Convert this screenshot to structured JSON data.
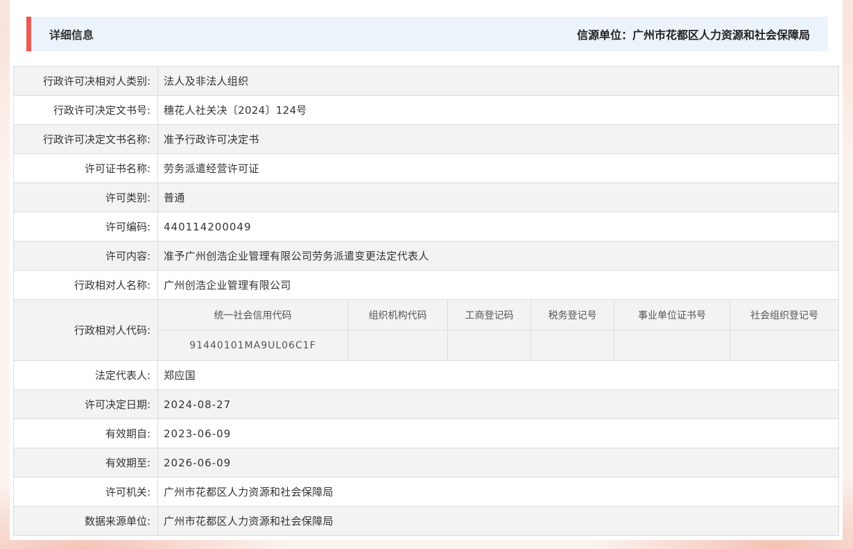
{
  "header": {
    "title": "详细信息",
    "source": "信源单位：广州市花都区人力资源和社会保障局"
  },
  "colors": {
    "accent": "#e85a52",
    "header_bg": "#edf3fa",
    "row_alt": "#f3f3f3"
  },
  "rows": {
    "r1": {
      "label": "行政许可决相对人类别:",
      "value": "法人及非法人组织"
    },
    "r2": {
      "label": "行政许可决定文书号:",
      "value": "穗花人社关决〔2024〕124号"
    },
    "r3": {
      "label": "行政许可决定文书名称:",
      "value": "准予行政许可决定书"
    },
    "r4": {
      "label": "许可证书名称:",
      "value": "劳务派遣经营许可证"
    },
    "r5": {
      "label": "许可类别:",
      "value": "普通"
    },
    "r6": {
      "label": "许可编码:",
      "value": "440114200049"
    },
    "r7": {
      "label": "许可内容:",
      "value": "准予广州创浩企业管理有限公司劳务派遣变更法定代表人"
    },
    "r8": {
      "label": "行政相对人名称:",
      "value": "广州创浩企业管理有限公司"
    },
    "r9": {
      "label": "行政相对人代码:"
    },
    "r10": {
      "label": "法定代表人:",
      "value": "郑应国"
    },
    "r11": {
      "label": "许可决定日期:",
      "value": "2024-08-27"
    },
    "r12": {
      "label": "有效期自:",
      "value": "2023-06-09"
    },
    "r13": {
      "label": "有效期至:",
      "value": "2026-06-09"
    },
    "r14": {
      "label": "许可机关:",
      "value": "广州市花都区人力资源和社会保障局"
    },
    "r15": {
      "label": "数据来源单位:",
      "value": "广州市花都区人力资源和社会保障局"
    }
  },
  "codes": {
    "headers": [
      "统一社会信用代码",
      "组织机构代码",
      "工商登记码",
      "税务登记号",
      "事业单位证书号",
      "社会组织登记号"
    ],
    "values": [
      "91440101MA9UL06C1F",
      "",
      "",
      "",
      "",
      ""
    ]
  }
}
